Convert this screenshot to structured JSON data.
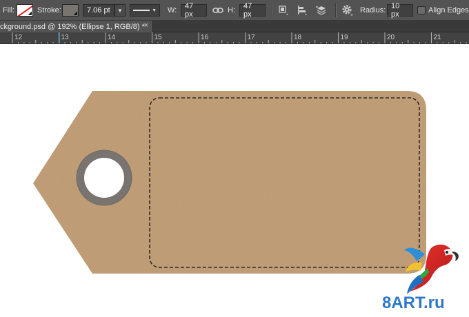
{
  "options_bar": {
    "fill_label": "Fill:",
    "stroke_label": "Stroke:",
    "stroke_width": "7.06 pt",
    "width_label": "W:",
    "width_value": "47 px",
    "height_label": "H:",
    "height_value": "47 px",
    "radius_label": "Radius:",
    "radius_value": "10 px",
    "align_edges_label": "Align Edges",
    "align_edges_checked": false,
    "stroke_color": "#7a7470",
    "fill_icon": "no-fill-swatch",
    "icons": [
      "link-icon",
      "path-operations-icon",
      "path-alignment-icon",
      "path-arrangement-icon",
      "gear-icon"
    ]
  },
  "document": {
    "tab_title": "ckground.psd @ 192% (Ellipse 1, RGB/8) *",
    "close_symbol": "×"
  },
  "ruler": {
    "labels": [
      "12",
      "13",
      "14",
      "15",
      "16",
      "17",
      "18",
      "19",
      "20",
      "21"
    ]
  },
  "canvas": {
    "tag_color": "#c4a078",
    "hole_ring_color": "#7a7470",
    "stitch_color": "#2e2a26"
  },
  "watermark": {
    "text": "8ART.ru"
  }
}
